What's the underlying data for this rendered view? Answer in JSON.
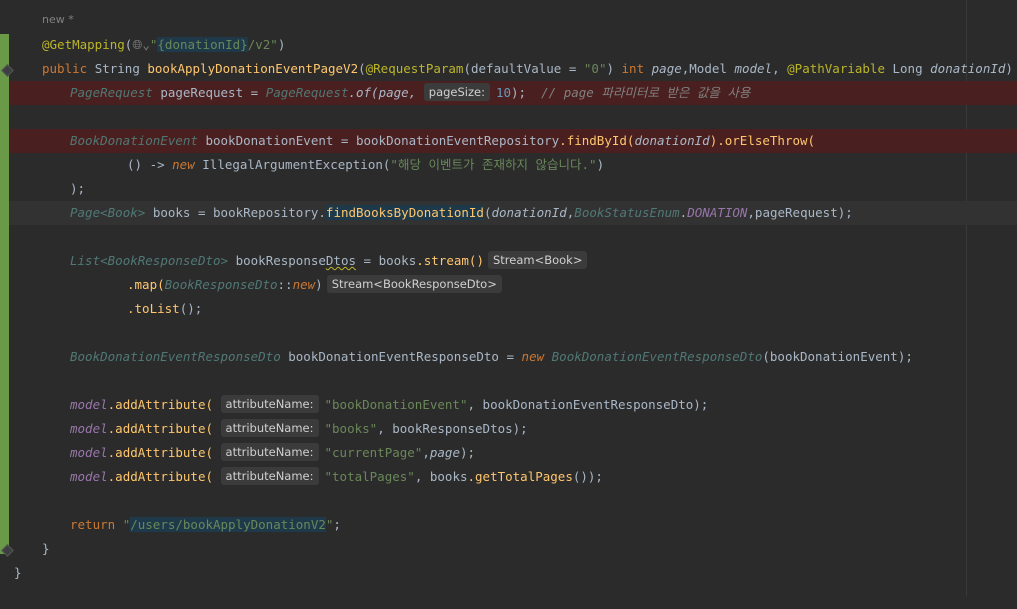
{
  "editor": {
    "author_hint": "new *",
    "lines": {
      "l1_ann": "@GetMapping",
      "l1_open": "(",
      "l1_icon": "globe-icon",
      "l1_str_q1": "\"",
      "l1_str_hl": "{donationId}",
      "l1_str_rest": "/v2\"",
      "l1_close": ")",
      "l2_public": "public ",
      "l2_type": "String ",
      "l2_meth": "bookApplyDonationEventPageV2",
      "l2_open": "(",
      "l2_ann1": "@RequestParam",
      "l2_p1": "(defaultValue = ",
      "l2_str": "\"0\"",
      "l2_p2": ") ",
      "l2_int": "int ",
      "l2_page": "page",
      "l2_comma": ",",
      "l2_model_t": "Model ",
      "l2_model": "model",
      "l2_comma2": ", ",
      "l2_ann2": "@PathVariable ",
      "l2_long": "Long ",
      "l2_did": "donationId",
      "l2_end": ") {",
      "l3_type": "PageRequest",
      "l3_var": " pageRequest = ",
      "l3_cls": "PageRequest",
      "l3_of": ".of(",
      "l3_page": "page,",
      "l3_hint": "pageSize:",
      "l3_num": "10",
      "l3_end": ");",
      "l3_cmt": "  // page 파라미터로 받은 값을 사용",
      "l5_type": "BookDonationEvent",
      "l5_var": " bookDonationEvent = bookDonationEventRepository",
      "l5_find": ".findById(",
      "l5_did": "donationId",
      "l5_or": ").orElseThrow(",
      "l6_lambda": "() -> ",
      "l6_new": "new ",
      "l6_exc": "IllegalArgumentException",
      "l6_open": "(",
      "l6_str": "\"해당 이벤트가 존재하지 않습니다.\"",
      "l6_end": ")",
      "l7_end": ");",
      "l8_page": "Page",
      "l8_lt": "<",
      "l8_book": "Book",
      "l8_gt": "> ",
      "l8_var": "books = bookRepository",
      "l8_dot": ".",
      "l8_find": "findBooksByDonationId",
      "l8_open": "(",
      "l8_did": "donationId",
      "l8_comma": ",",
      "l8_enum": "BookStatusEnum",
      "l8_dot2": ".",
      "l8_don": "DONATION",
      "l8_rest": ",pageRequest);",
      "l10_list": "List",
      "l10_lt": "<",
      "l10_dto": "BookResponseDto",
      "l10_gt": "> ",
      "l10_var_a": "bookResponse",
      "l10_var_b": "Dtos",
      "l10_eq": " = books",
      "l10_stream": ".stream()",
      "l10_hint": "Stream<Book>",
      "l11_map": ".map(",
      "l11_cls": "BookResponseDto",
      "l11_ref": "::",
      "l11_new": "new",
      "l11_end": ")",
      "l11_hint": "Stream<BookResponseDto>",
      "l12_tolist": ".toList",
      "l12_end": "();",
      "l14_type": "BookDonationEventResponseDto",
      "l14_var": " bookDonationEventResponseDto = ",
      "l14_new": "new ",
      "l14_cls": "BookDonationEventResponseDto",
      "l14_end": "(bookDonationEvent);",
      "attr_model": "model",
      "attr_method": ".addAttribute(",
      "attr_hint": "attributeName:",
      "l16_str": "\"bookDonationEvent\"",
      "l16_rest": ", bookDonationEventResponseDto);",
      "l17_str": "\"books\"",
      "l17_rest": ", bookResponseDtos);",
      "l18_str": "\"currentPage\"",
      "l18_comma": ",",
      "l18_page": "page",
      "l18_end": ");",
      "l19_str": "\"totalPages\"",
      "l19_rest_a": ", books",
      "l19_get": ".getTotalPages",
      "l19_end": "());",
      "l21_return": "return ",
      "l21_q": "\"",
      "l21_hl": "/users/bookApplyDonationV2",
      "l21_end_q": "\"",
      "l21_semi": ";",
      "l22_brace": "}",
      "l23_brace": "}"
    }
  }
}
